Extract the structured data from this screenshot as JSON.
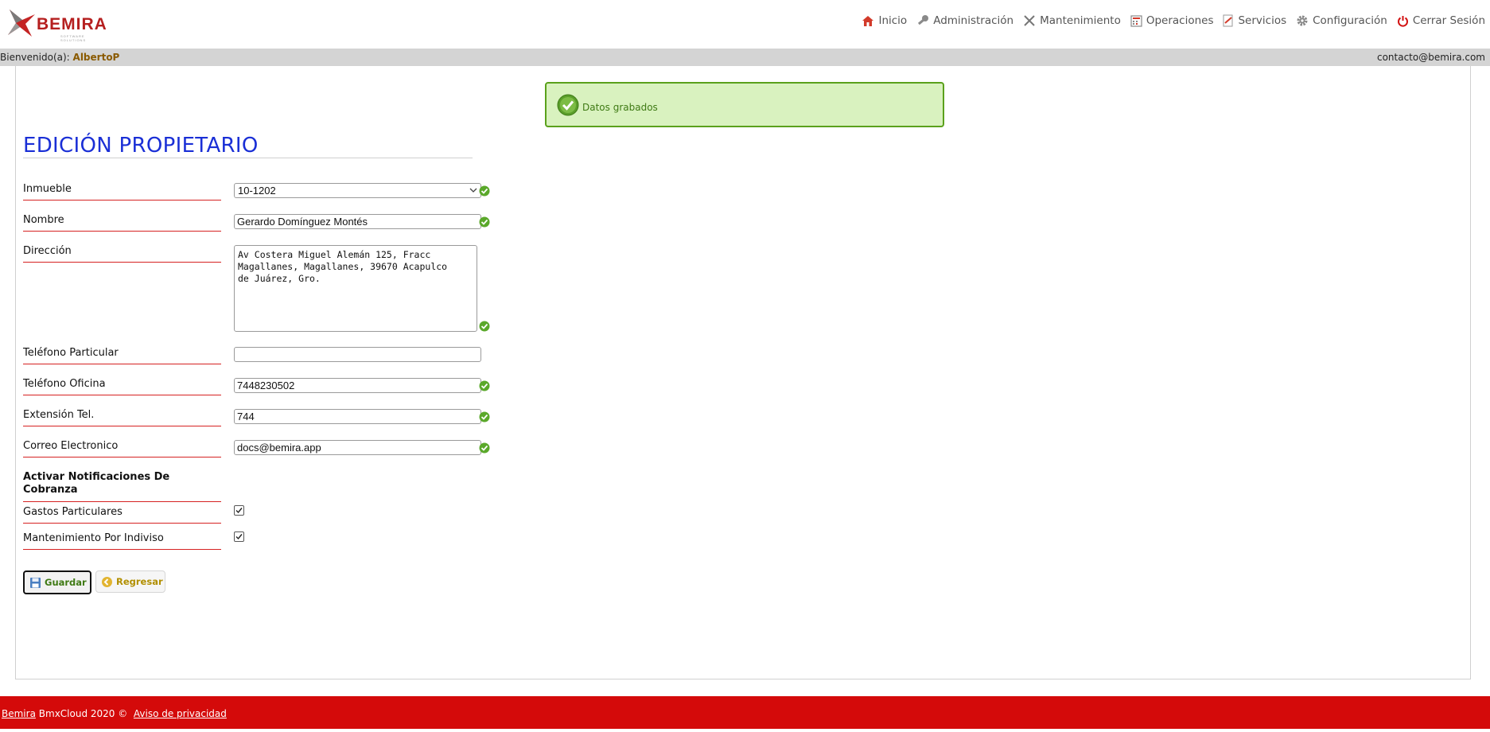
{
  "header": {
    "logo_text": "BEMIRA",
    "logo_tagline": "SOFTWARE SOLUTIONS",
    "nav": [
      {
        "label": "Inicio",
        "icon": "home-icon"
      },
      {
        "label": "Administración",
        "icon": "key-icon"
      },
      {
        "label": "Mantenimiento",
        "icon": "tools-icon"
      },
      {
        "label": "Operaciones",
        "icon": "calculator-icon"
      },
      {
        "label": "Servicios",
        "icon": "document-icon"
      },
      {
        "label": "Configuración",
        "icon": "gear-icon"
      },
      {
        "label": "Cerrar Sesión",
        "icon": "power-icon"
      }
    ]
  },
  "welcome": {
    "prefix": "Bienvenido(a):",
    "user": "AlbertoP",
    "contact": "contacto@bemira.com"
  },
  "message": {
    "text": "Datos grabados"
  },
  "form": {
    "title": "EDICIÓN PROPIETARIO",
    "inmueble": {
      "label": "Inmueble",
      "value": "10-1202"
    },
    "nombre": {
      "label": "Nombre",
      "value": "Gerardo Domínguez Montés"
    },
    "direccion": {
      "label": "Dirección",
      "value": "Av Costera Miguel Alemán 125, Fracc\nMagallanes, Magallanes, 39670 Acapulco\nde Juárez, Gro."
    },
    "telefono_particular": {
      "label": "Teléfono Particular",
      "value": ""
    },
    "telefono_oficina": {
      "label": "Teléfono Oficina",
      "value": "7448230502"
    },
    "extension": {
      "label": "Extensión Tel.",
      "value": "744"
    },
    "correo": {
      "label": "Correo Electronico",
      "value": "docs@bemira.app"
    },
    "notificaciones_heading": "Activar Notificaciones De Cobranza",
    "gastos": {
      "label": "Gastos Particulares",
      "checked": true
    },
    "indiviso": {
      "label": "Mantenimiento Por Indiviso",
      "checked": true
    }
  },
  "buttons": {
    "save": "Guardar",
    "back": "Regresar"
  },
  "footer": {
    "brand": "Bemira",
    "text": "BmxCloud 2020 ©",
    "privacy": "Aviso de privacidad"
  },
  "colors": {
    "accent_red": "#d40a0a",
    "title_blue": "#1a2fd6",
    "success_green": "#5aa11b"
  }
}
